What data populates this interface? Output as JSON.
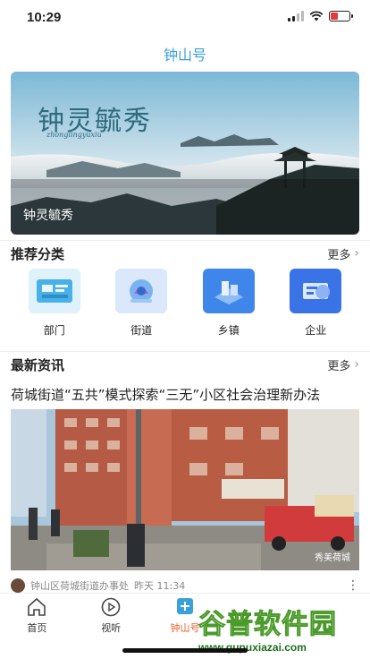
{
  "status_bar": {
    "time": "10:29"
  },
  "header": {
    "title": "钟山号"
  },
  "banner": {
    "title": "钟灵毓秀",
    "subtitle": "zhonglingyuxiu",
    "caption": "钟灵毓秀"
  },
  "recommend": {
    "title": "推荐分类",
    "more": "更多",
    "items": [
      {
        "label": "部门",
        "icon": "department-icon"
      },
      {
        "label": "街道",
        "icon": "street-icon"
      },
      {
        "label": "乡镇",
        "icon": "township-icon"
      },
      {
        "label": "企业",
        "icon": "enterprise-icon"
      }
    ]
  },
  "news": {
    "title": "最新资讯",
    "more": "更多",
    "headline": "荷城街道“五共”模式探索“三无”小区社会治理新办法",
    "image_watermark": "秀美荷城",
    "source": "钟山区荷城街道办事处",
    "time": "昨天 11:34"
  },
  "tabbar": {
    "items": [
      {
        "label": "首页",
        "icon": "home-icon",
        "active": false
      },
      {
        "label": "视听",
        "icon": "play-icon",
        "active": false
      },
      {
        "label": "钟山号",
        "icon": "plus-square-icon",
        "active": true
      },
      {
        "label": "",
        "icon": "",
        "active": false
      },
      {
        "label": "",
        "icon": "",
        "active": false
      }
    ]
  },
  "watermark": {
    "text": "谷普软件园",
    "url": "www.gupuxiazai.com"
  },
  "colors": {
    "accent": "#3aa0d8",
    "active_tab": "#e8622c"
  }
}
